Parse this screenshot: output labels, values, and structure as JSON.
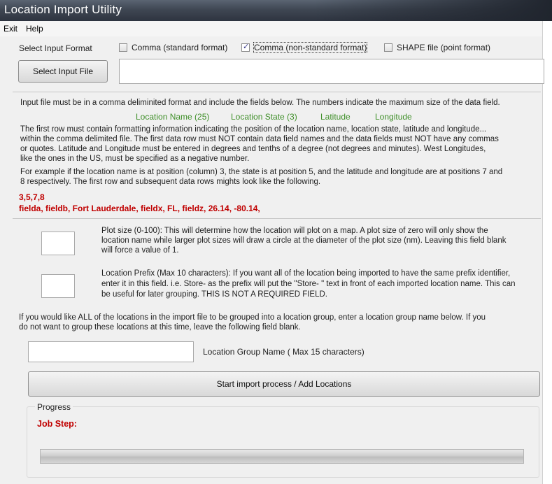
{
  "window": {
    "title": "Location Import Utility"
  },
  "menu": {
    "items": [
      "Exit",
      "Help"
    ]
  },
  "format": {
    "label": "Select Input Format",
    "options": [
      {
        "label": "Comma (standard format)",
        "checked": false
      },
      {
        "label": "Comma (non-standard format)",
        "checked": true
      },
      {
        "label": "SHAPE file (point format)",
        "checked": false
      }
    ]
  },
  "input_file": {
    "button_label": "Select Input File",
    "value": ""
  },
  "instructions": {
    "line1": "Input file must be in a comma deliminited format and include the fields below.  The numbers indicate the maximum size of the data field.",
    "fields": [
      "Location Name (25)",
      "Location State (3)",
      "Latitude",
      "Longitude"
    ],
    "para1": [
      "The first row must contain formatting information indicating the position of the location name, location state, latitude and longitude...",
      "within the comma delimited file.  The first data row must NOT contain data field names and the data fields must NOT have any commas",
      "or quotes.  Latitude and Longitude must be entered in degrees and tenths of a degree (not degrees and minutes).  West Longitudes,",
      "like the ones in the US, must be specified as a negative number."
    ],
    "para2": [
      "For example if the location name is at position (column) 3, the state is at position 5, and the latitude and longitude are at positions 7 and",
      "8 respectively.  The first row and subsequent data rows mights look like the following."
    ],
    "example_row1": "3,5,7,8",
    "example_row2": "fielda, fieldb, Fort Lauderdale, fieldx, FL, fieldz, 26.14, -80.14,"
  },
  "plot_size": {
    "value": "",
    "description": [
      "Plot size (0-100):  This will determine how the location will plot on a map.  A plot size of zero will only show the",
      "location name while larger plot sizes will draw a circle at the diameter of the plot size (nm).  Leaving this field blank",
      "will force a value of 1."
    ]
  },
  "prefix": {
    "value": "",
    "description": [
      "Location Prefix (Max 10 characters):  If you want all of the location being imported to have the same prefix identifier,",
      "enter it in this field.  i.e. Store- as the prefix will put the \"Store- \" text in front of each imported location name.  This can",
      "be useful for later grouping.  THIS IS NOT A REQUIRED FIELD."
    ]
  },
  "group": {
    "intro": [
      "If you would like ALL of the locations in the import file to be grouped into a location group, enter a location group name below.  If you",
      "do not want to group these locations at this time, leave the following field blank."
    ],
    "label": "Location Group Name ( Max 15 characters)",
    "value": ""
  },
  "start_button": {
    "label": "Start import process / Add Locations"
  },
  "progress": {
    "legend": "Progress",
    "job_step_label": "Job Step:",
    "fraction": 0
  },
  "colors": {
    "accent_green": "#3f8f29",
    "alert_red": "#c00000"
  }
}
